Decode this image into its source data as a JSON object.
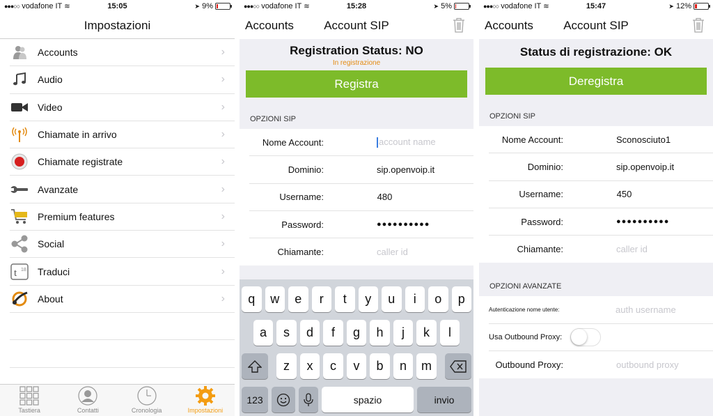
{
  "screen1": {
    "status": {
      "carrier": "vodafone IT",
      "time": "15:05",
      "battery": "9%",
      "battery_level": 0.09
    },
    "nav": {
      "title": "Impostazioni"
    },
    "items": [
      {
        "label": "Accounts",
        "icon": "accounts-icon"
      },
      {
        "label": "Audio",
        "icon": "music-note-icon"
      },
      {
        "label": "Video",
        "icon": "video-camera-icon"
      },
      {
        "label": "Chiamate in arrivo",
        "icon": "antenna-icon"
      },
      {
        "label": "Chiamate registrate",
        "icon": "record-icon"
      },
      {
        "label": "Avanzate",
        "icon": "wrench-icon"
      },
      {
        "label": "Premium features",
        "icon": "cart-icon"
      },
      {
        "label": "Social",
        "icon": "share-icon"
      },
      {
        "label": "Traduci",
        "icon": "translate-icon"
      },
      {
        "label": "About",
        "icon": "about-icon"
      }
    ],
    "tabs": [
      {
        "label": "Tastiera",
        "icon": "keypad-icon"
      },
      {
        "label": "Contatti",
        "icon": "contact-icon"
      },
      {
        "label": "Cronologia",
        "icon": "clock-icon"
      },
      {
        "label": "Impostazioni",
        "icon": "gear-icon",
        "active": true
      }
    ],
    "accent": "#f39c12"
  },
  "screen2": {
    "status": {
      "carrier": "vodafone IT",
      "time": "15:28",
      "battery": "5%",
      "battery_level": 0.05
    },
    "nav": {
      "back": "Accounts",
      "title": "Account SIP"
    },
    "registration_title": "Registration Status: NO",
    "registration_sub": "In registrazione",
    "button": "Registra",
    "section": "OPZIONI SIP",
    "fields": [
      {
        "label": "Nome Account:",
        "value": "",
        "placeholder": "account name"
      },
      {
        "label": "Dominio:",
        "value": "sip.openvoip.it",
        "placeholder": ""
      },
      {
        "label": "Username:",
        "value": "480",
        "placeholder": ""
      },
      {
        "label": "Password:",
        "value": "●●●●●●●●●●",
        "placeholder": ""
      },
      {
        "label": "Chiamante:",
        "value": "",
        "placeholder": "caller id"
      }
    ],
    "keyboard": {
      "row1": [
        "q",
        "w",
        "e",
        "r",
        "t",
        "y",
        "u",
        "i",
        "o",
        "p"
      ],
      "row2": [
        "a",
        "s",
        "d",
        "f",
        "g",
        "h",
        "j",
        "k",
        "l"
      ],
      "row3": [
        "z",
        "x",
        "c",
        "v",
        "b",
        "n",
        "m"
      ],
      "num_label": "123",
      "space_label": "spazio",
      "return_label": "invio"
    },
    "button_color": "#7dbb2a"
  },
  "screen3": {
    "status": {
      "carrier": "vodafone IT",
      "time": "15:47",
      "battery": "12%",
      "battery_level": 0.12
    },
    "nav": {
      "back": "Accounts",
      "title": "Account SIP"
    },
    "registration_title": "Status di registrazione: OK",
    "button": "Deregistra",
    "section": "OPZIONI SIP",
    "fields": [
      {
        "label": "Nome Account:",
        "value": "Sconosciuto1",
        "placeholder": ""
      },
      {
        "label": "Dominio:",
        "value": "sip.openvoip.it",
        "placeholder": ""
      },
      {
        "label": "Username:",
        "value": "450",
        "placeholder": ""
      },
      {
        "label": "Password:",
        "value": "●●●●●●●●●●",
        "placeholder": ""
      },
      {
        "label": "Chiamante:",
        "value": "",
        "placeholder": "caller id"
      }
    ],
    "advanced_section": "OPZIONI AVANZATE",
    "advanced": {
      "auth_label": "Autenticazione nome utente:",
      "auth_placeholder": "auth username",
      "proxy_toggle_label": "Usa Outbound Proxy:",
      "proxy_toggle_on": false,
      "proxy_label": "Outbound Proxy:",
      "proxy_placeholder": "outbound proxy"
    }
  }
}
